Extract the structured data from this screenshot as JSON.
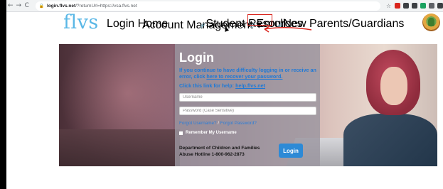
{
  "browser": {
    "back_glyph": "←",
    "forward_glyph": "→",
    "reload_glyph": "C",
    "lock_glyph": "🔒",
    "url_host": "login.flvs.net",
    "url_path": "/?returnUrl=https://vsa.flvs.net",
    "bookmark_glyph": "☆",
    "extension_colors": [
      "#d9241c",
      "#3c4043",
      "#3c4043",
      "#1aa260",
      "#5f6368",
      "#3c4043"
    ]
  },
  "header": {
    "logo": "flvs",
    "nav": {
      "login_home": "Login Home",
      "account_management": "Account Management",
      "account_caret": "▾",
      "student_resources": "Student Resources",
      "enroll": "Enroll",
      "new_parents": "New Parents/Guardians",
      "clip_glyph": "🔗"
    },
    "annotation_color": "#d9241c"
  },
  "login": {
    "title": "Login",
    "message_pre": "If you continue to have difficulty logging in or receive an error, click ",
    "message_link": "here to recover your password.",
    "help_pre": "Click this link for help: ",
    "help_link": "help.flvs.net",
    "username_placeholder": "Username",
    "password_placeholder": "Password (Case Sensitive)",
    "forgot_username": "Forgot Username?",
    "forgot_separator": " / ",
    "forgot_password": "Forgot Password?",
    "remember_label": "Remember My Username",
    "dept_line1": "Department of Children and Families",
    "dept_line2": "Abuse Hotline 1-800-962-2873",
    "button_label": "Login"
  }
}
